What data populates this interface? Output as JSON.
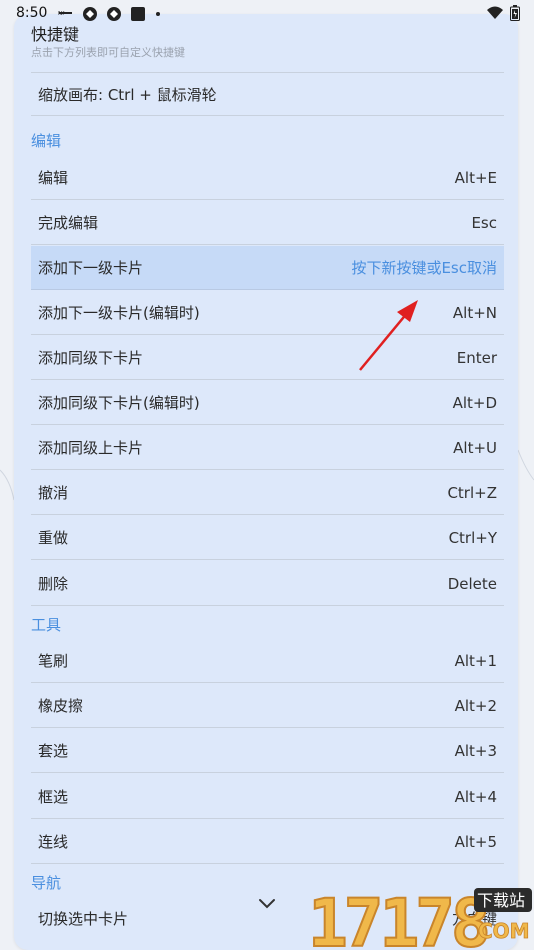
{
  "status_bar": {
    "time": "8:50",
    "left_icons": [
      "nfc-icon",
      "sync-icon",
      "sync-icon",
      "app-icon",
      "dot-icon"
    ],
    "right_icons": [
      "wifi-icon",
      "battery-icon"
    ]
  },
  "panel": {
    "title": "快捷键",
    "subtitle": "点击下方列表即可自定义快捷键",
    "zoom_row": "缩放画布: Ctrl + 鼠标滑轮"
  },
  "sections": {
    "edit": "编辑",
    "tools": "工具",
    "nav": "导航"
  },
  "edit_rows": [
    {
      "label": "编辑",
      "key": "Alt+E"
    },
    {
      "label": "完成编辑",
      "key": "Esc"
    },
    {
      "label": "添加下一级卡片",
      "key": "按下新按键或Esc取消"
    },
    {
      "label": "添加下一级卡片(编辑时)",
      "key": "Alt+N"
    },
    {
      "label": "添加同级下卡片",
      "key": "Enter"
    },
    {
      "label": "添加同级下卡片(编辑时)",
      "key": "Alt+D"
    },
    {
      "label": "添加同级上卡片",
      "key": "Alt+U"
    },
    {
      "label": "撤消",
      "key": "Ctrl+Z"
    },
    {
      "label": "重做",
      "key": "Ctrl+Y"
    },
    {
      "label": "删除",
      "key": "Delete"
    }
  ],
  "tool_rows": [
    {
      "label": "笔刷",
      "key": "Alt+1"
    },
    {
      "label": "橡皮擦",
      "key": "Alt+2"
    },
    {
      "label": "套选",
      "key": "Alt+3"
    },
    {
      "label": "框选",
      "key": "Alt+4"
    },
    {
      "label": "连线",
      "key": "Alt+5"
    }
  ],
  "nav_rows": [
    {
      "label": "切换选中卡片",
      "key": "方向键"
    }
  ],
  "watermark": {
    "number": "17178",
    "text_top": "下载站",
    "text_bottom": "COM"
  },
  "colors": {
    "panel_bg": "#dde8fa",
    "accent": "#4a8fdf",
    "highlight": "#c6daf7",
    "arrow": "#e02020"
  }
}
